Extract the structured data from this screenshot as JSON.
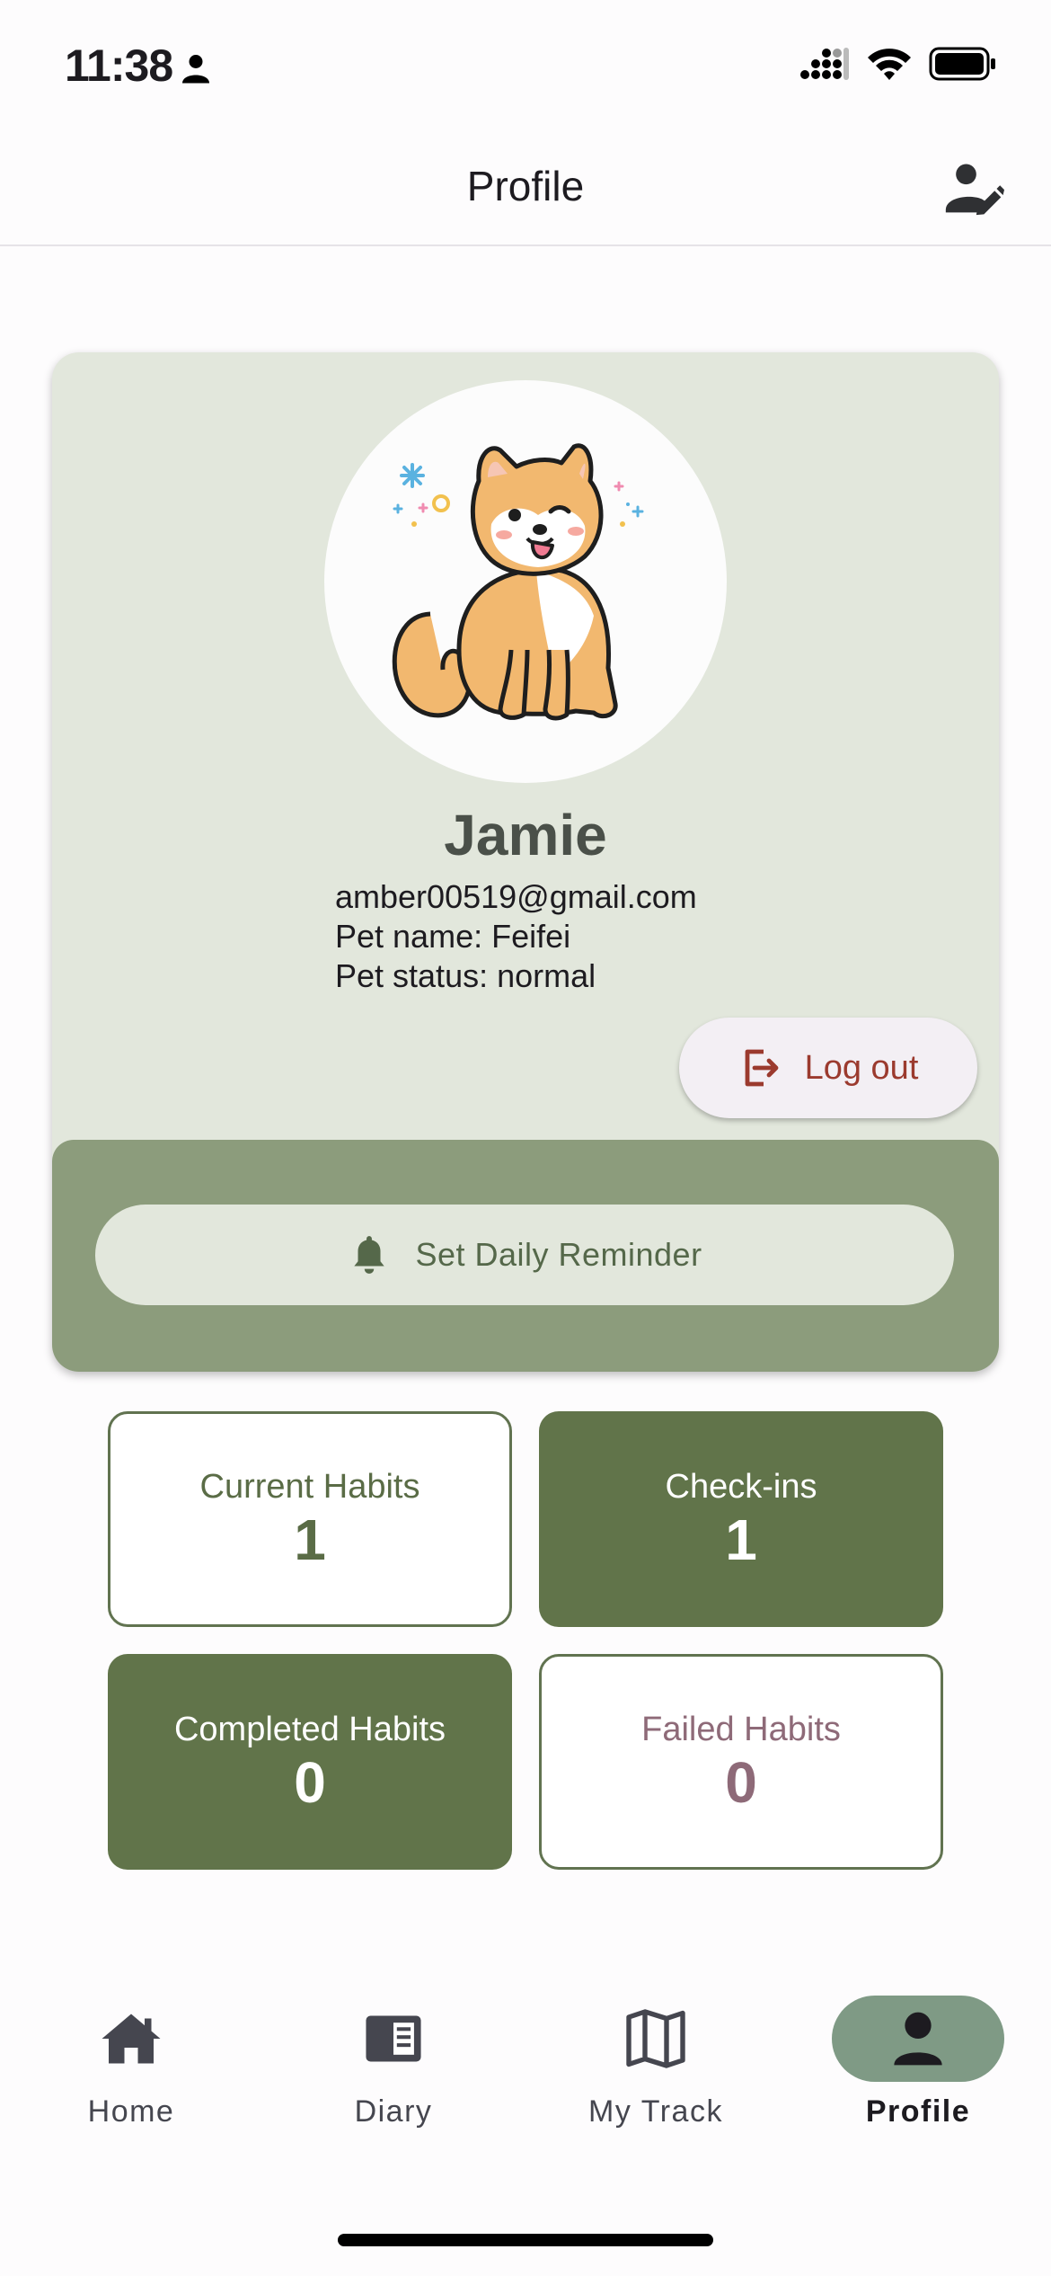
{
  "status_bar": {
    "time": "11:38"
  },
  "app_bar": {
    "title": "Profile"
  },
  "profile": {
    "name": "Jamie",
    "email": "amber00519@gmail.com",
    "pet_name_line": "Pet name: Feifei",
    "pet_status_line": "Pet status: normal",
    "logout_label": "Log out",
    "reminder_label": "Set Daily Reminder"
  },
  "stats": [
    {
      "label": "Current Habits",
      "value": "1"
    },
    {
      "label": "Check-ins",
      "value": "1"
    },
    {
      "label": "Completed Habits",
      "value": "0"
    },
    {
      "label": "Failed Habits",
      "value": "0"
    }
  ],
  "nav": {
    "items": [
      {
        "label": "Home",
        "icon": "home-icon"
      },
      {
        "label": "Diary",
        "icon": "diary-icon"
      },
      {
        "label": "My Track",
        "icon": "map-icon"
      },
      {
        "label": "Profile",
        "icon": "person-icon"
      }
    ],
    "active": "Profile"
  },
  "colors": {
    "card_background": "#e2e7dc",
    "reminder_panel": "#8c9c7c",
    "accent_green": "#61744a",
    "logout_text": "#9b3a2e",
    "failed_text": "#8e6a78",
    "active_nav_pill": "#7f9a85"
  }
}
